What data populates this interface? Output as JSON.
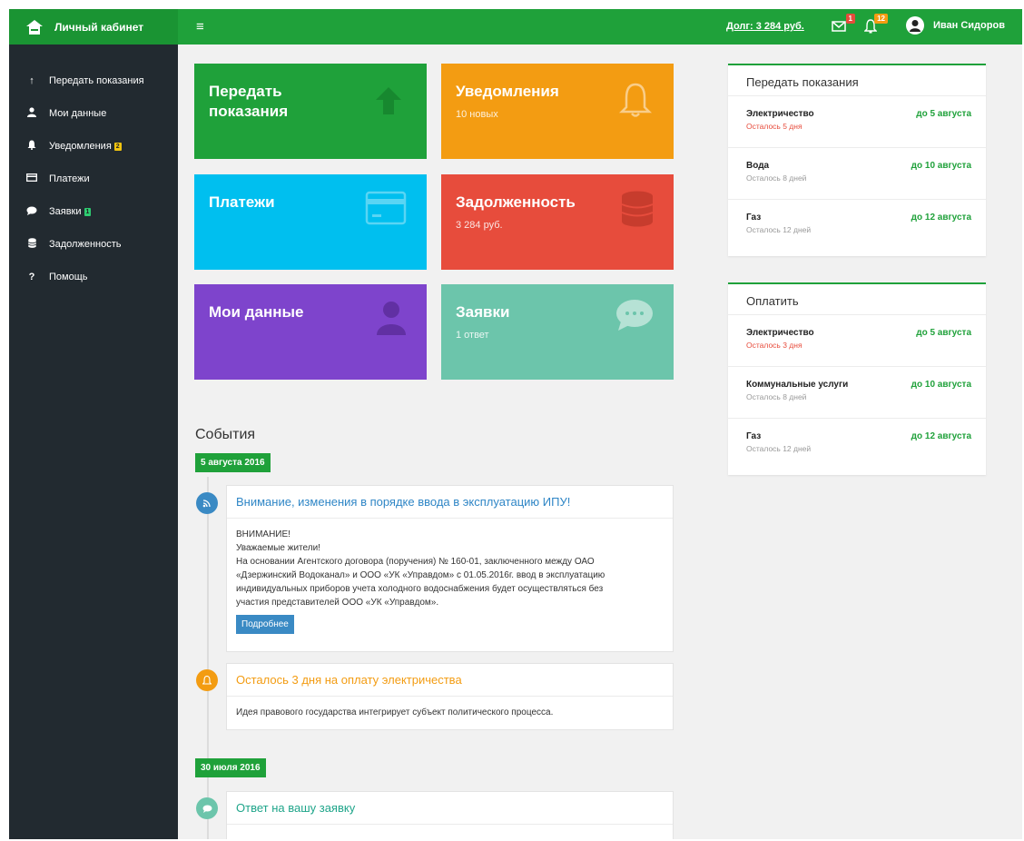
{
  "header": {
    "brand": "Личный кабинет",
    "debt_link": "Долг: 3 284 руб.",
    "mail_badge": "1",
    "bell_badge": "12",
    "user_name": "Иван Сидоров",
    "colors": {
      "primary": "#1fa13a",
      "sidebar": "#222a30"
    }
  },
  "sidebar": {
    "items": [
      {
        "label": "Передать показания",
        "icon": "arrow-up-icon"
      },
      {
        "label": "Мои данные",
        "icon": "user-icon"
      },
      {
        "label": "Уведомления",
        "icon": "bell-icon",
        "badge": "2"
      },
      {
        "label": "Платежи",
        "icon": "card-icon"
      },
      {
        "label": "Заявки",
        "icon": "chat-icon",
        "badge": "1"
      },
      {
        "label": "Задолженность",
        "icon": "database-icon"
      },
      {
        "label": "Помощь",
        "icon": "question-icon"
      }
    ]
  },
  "tiles": {
    "readings": {
      "title": "Передать показания",
      "color": "#1fa13a",
      "icon": "arrow-up-icon"
    },
    "notifications": {
      "title": "Уведомления",
      "subtitle": "10 новых",
      "color": "#f39c12",
      "icon": "bell-icon"
    },
    "payments": {
      "title": "Платежи",
      "color": "#00bfef",
      "icon": "card-icon"
    },
    "debt": {
      "title": "Задолженность",
      "subtitle": "3 284 руб.",
      "color": "#e74c3c",
      "icon": "database-icon"
    },
    "mydata": {
      "title": "Мои данные",
      "color": "#7e44cc",
      "icon": "user-icon"
    },
    "requests": {
      "title": "Заявки",
      "subtitle": "1 ответ",
      "color": "#6cc5ab",
      "icon": "chat-icon"
    }
  },
  "events": {
    "title": "События",
    "date1": "5 августа 2016",
    "date2": "30 июля 2016",
    "items": [
      {
        "title": "Внимание, изменения в порядке ввода в эксплуатацию ИПУ!",
        "lines": [
          "ВНИМАНИЕ!",
          "Уважаемые жители!",
          "На основании Агентского договора (поручения) № 160-01, заключенного между ОАО",
          "«Дзержинский Водоканал» и ООО «УК «Управдом» с 01.05.2016г. ввод в эксплуатацию",
          "индивидуальных приборов учета холодного водоснабжения будет осуществляться без",
          "участия представителей ООО «УК «Управдом»."
        ],
        "button": "Подробнее",
        "icon": "rss-icon",
        "color": "#3a8ac4"
      },
      {
        "title": "Осталось 3 дня на оплату электричества",
        "body": "Идея правового государства интегрирует субъект политического процесса.",
        "icon": "bell-icon",
        "color": "#f39c12"
      },
      {
        "title": "Ответ на вашу заявку",
        "icon": "chat-icon",
        "color": "#6cc5ab"
      }
    ]
  },
  "panels": {
    "readings": {
      "title": "Передать показания",
      "rows": [
        {
          "name": "Электричество",
          "remain": "Осталось 5 дня",
          "due": "до 5 августа",
          "urgent": true
        },
        {
          "name": "Вода",
          "remain": "Осталось 8 дней",
          "due": "до 10 августа",
          "urgent": false
        },
        {
          "name": "Газ",
          "remain": "Осталось 12 дней",
          "due": "до 12 августа",
          "urgent": false
        }
      ]
    },
    "pay": {
      "title": "Оплатить",
      "rows": [
        {
          "name": "Электричество",
          "remain": "Осталось 3 дня",
          "due": "до 5 августа",
          "urgent": true
        },
        {
          "name": "Коммунальные услуги",
          "remain": "Осталось 8 дней",
          "due": "до 10 августа",
          "urgent": false
        },
        {
          "name": "Газ",
          "remain": "Осталось 12 дней",
          "due": "до 12 августа",
          "urgent": false
        }
      ]
    }
  }
}
